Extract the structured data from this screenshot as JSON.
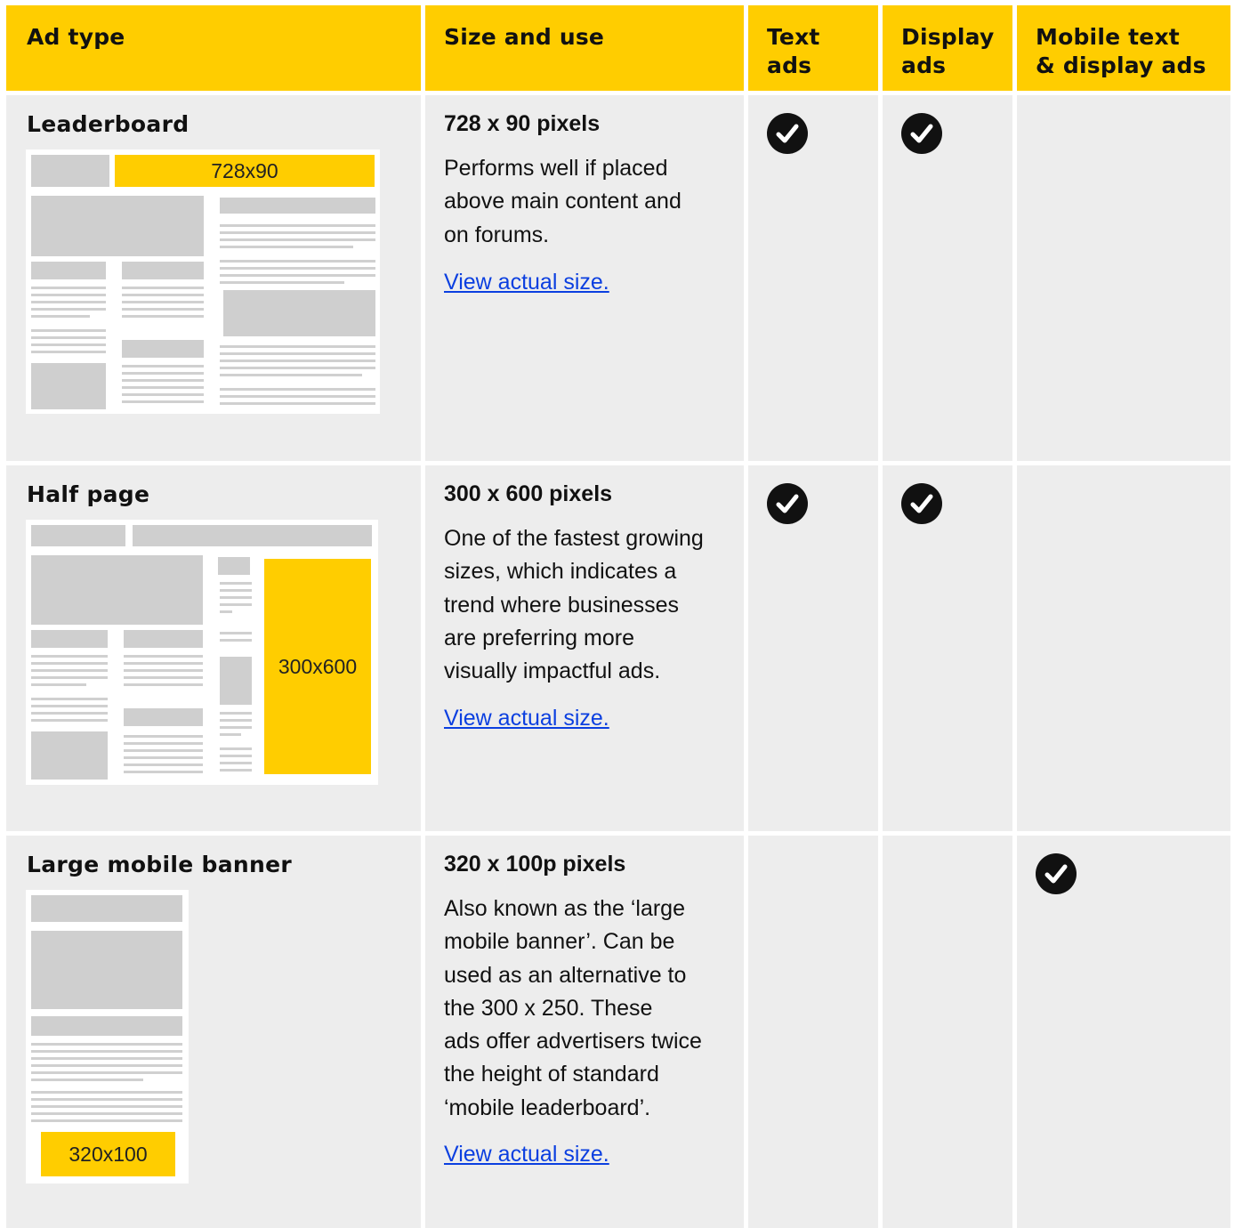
{
  "header": {
    "col1": "Ad type",
    "col2": "Size and use",
    "col3": [
      "Text",
      "ads"
    ],
    "col4": [
      "Display",
      "ads"
    ],
    "col5": [
      "Mobile text",
      "& display ads"
    ]
  },
  "rows": [
    {
      "name": "Leaderboard",
      "size": "728 x 90 pixels",
      "desc": "Performs well if placed\nabove main content and\non forums.",
      "link": "View actual size.",
      "ad_label": "728x90",
      "text_ads": true,
      "display_ads": true,
      "mobile_ads": false
    },
    {
      "name": "Half page",
      "size": "300 x 600 pixels",
      "desc": "One of the fastest growing\nsizes, which indicates a\ntrend where businesses\nare preferring more\nvisually impactful ads.",
      "link": "View actual size.",
      "ad_label": "300x600",
      "text_ads": true,
      "display_ads": true,
      "mobile_ads": false
    },
    {
      "name": "Large mobile banner",
      "size": "320 x 100p pixels",
      "desc": "Also known as the ‘large\nmobile banner’. Can be\nused as an alternative to\nthe 300 x 250. These\nads offer advertisers twice\nthe height of standard\n‘mobile leaderboard’.",
      "link": "View actual size.",
      "ad_label": "320x100",
      "text_ads": false,
      "display_ads": false,
      "mobile_ads": true
    }
  ],
  "icons": {
    "check": "check-circle-icon"
  },
  "colors": {
    "header_bg": "#FFCD00",
    "row_bg": "#EDEDED",
    "link": "#0B3FE0",
    "ad_fill": "#FFCD00"
  }
}
